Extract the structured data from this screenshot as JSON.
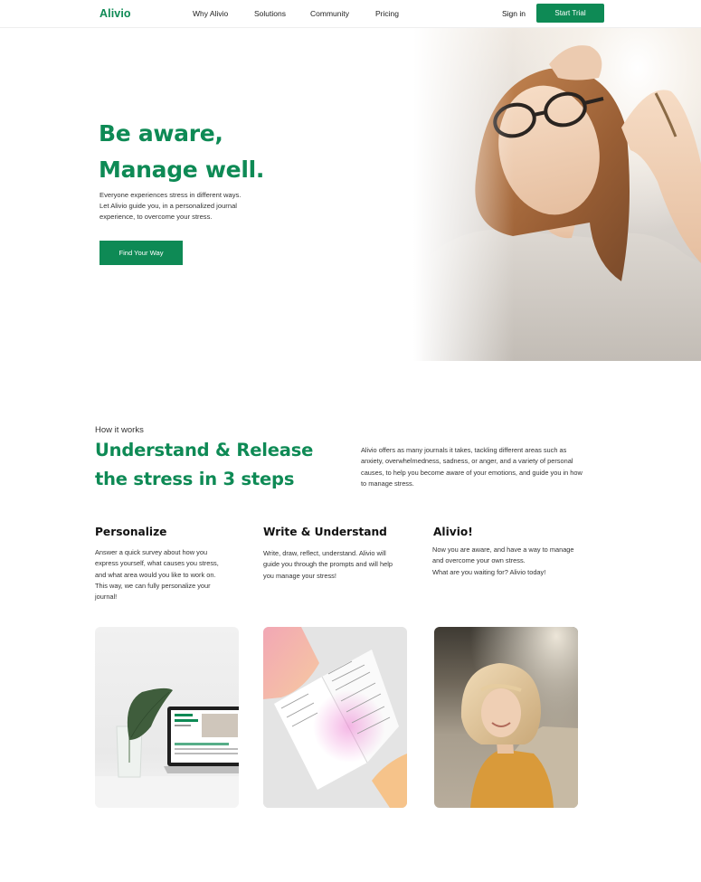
{
  "nav": {
    "logo": "Alivio",
    "links": [
      "Why Alivio",
      "Solutions",
      "Community",
      "Pricing"
    ],
    "signin": "Sign in",
    "cta": "Start Trial"
  },
  "hero": {
    "title_line1": "Be aware,",
    "title_line2": "Manage well.",
    "desc_line1": "Everyone experiences stress in different ways.",
    "desc_line2": "Let Alivio guide you, in a personalized journal",
    "desc_line3": "experience, to overcome your stress.",
    "button": "Find Your Way"
  },
  "how": {
    "label": "How it works",
    "title_line1": "Understand & Release",
    "title_line2": "the stress in 3 steps",
    "desc_line1": "Alivio offers as many journals it takes, tackling different areas such as",
    "desc_line2": "anxiety, overwhelmedness, sadness, or anger, and a variety of personal",
    "desc_line3": "causes, to help you become aware of your emotions, and guide you in how",
    "desc_line4": "to manage stress."
  },
  "steps": [
    {
      "title": "Personalize",
      "lines": [
        "Answer a quick survey about how you",
        "express yourself, what causes you stress,",
        "and what area would you like to work on.",
        "This way, we can fully personalize your",
        "journal!"
      ]
    },
    {
      "title": "Write & Understand",
      "lines": [
        "Write, draw, reflect, understand. Alivio will",
        "guide you through the prompts and will help",
        "you manage your stress!"
      ]
    },
    {
      "title": "Alivio!",
      "lines": [
        "Now you are aware, and have a way to manage",
        "and overcome your own stress.",
        "What are you waiting for? Alivio today!"
      ]
    }
  ],
  "colors": {
    "brand": "#0e8a55",
    "text": "#222222"
  }
}
